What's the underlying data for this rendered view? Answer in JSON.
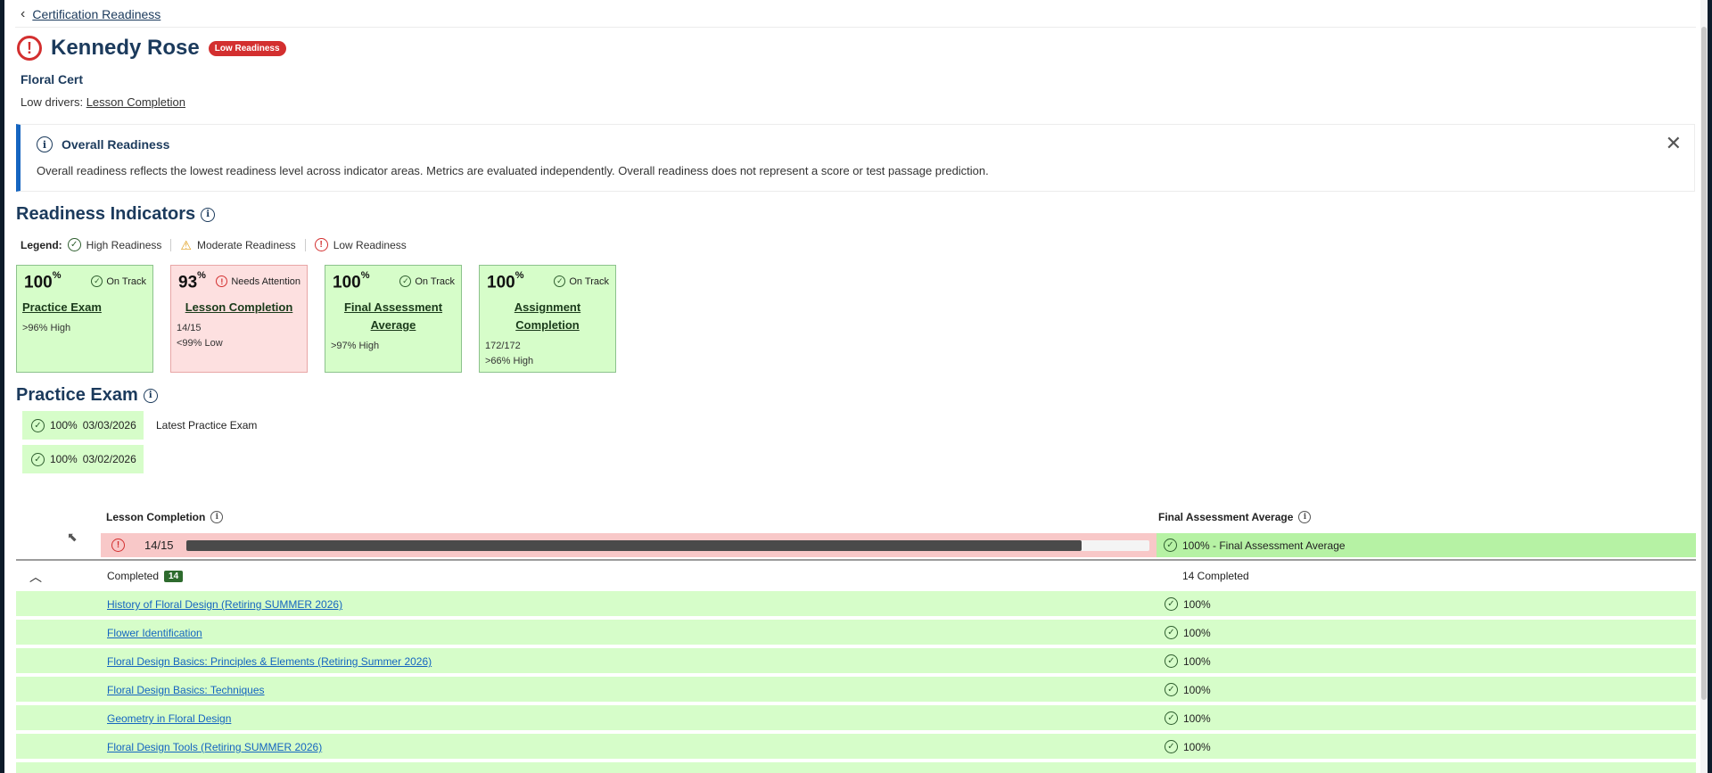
{
  "breadcrumb": {
    "back_label": "Certification Readiness"
  },
  "student": {
    "name": "Kennedy Rose",
    "readiness_badge": "Low Readiness",
    "cert": "Floral Cert",
    "drivers_label": "Low drivers:",
    "drivers_value": "Lesson Completion"
  },
  "info_box": {
    "title": "Overall Readiness",
    "text": "Overall readiness reflects the lowest readiness level across indicator areas. Metrics are evaluated independently. Overall readiness does not represent a score or test passage prediction."
  },
  "indicators": {
    "title": "Readiness Indicators",
    "legend": {
      "label": "Legend:",
      "high": "High Readiness",
      "moderate": "Moderate Readiness",
      "low": "Low Readiness"
    },
    "cards": [
      {
        "pct": "100",
        "status": "On Track",
        "title_line1": "Practice Exam",
        "title_line2": "",
        "meta1": ">96% High",
        "meta2": "",
        "level": "high"
      },
      {
        "pct": "93",
        "status": "Needs Attention",
        "title_line1": "Lesson Completion",
        "title_line2": "",
        "meta1": "14/15",
        "meta2": "<99% Low",
        "level": "low"
      },
      {
        "pct": "100",
        "status": "On Track",
        "title_line1": "Final Assessment",
        "title_line2": "Average",
        "meta1": ">97% High",
        "meta2": "",
        "level": "high"
      },
      {
        "pct": "100",
        "status": "On Track",
        "title_line1": "Assignment",
        "title_line2": "Completion",
        "meta1": "172/172",
        "meta2": ">66% High",
        "level": "high"
      }
    ],
    "pct_symbol": "%"
  },
  "practice_exam": {
    "title": "Practice Exam",
    "attempts": [
      {
        "score": "100%",
        "date": "03/03/2026"
      },
      {
        "score": "100%",
        "date": "03/02/2026"
      }
    ],
    "latest_label": "Latest Practice Exam"
  },
  "lesson_table": {
    "col_lesson": "Lesson Completion",
    "col_final": "Final Assessment Average",
    "progress": {
      "count": "14/15",
      "fraction": 0.93,
      "final_text": "100% - Final Assessment Average"
    },
    "completed": {
      "label": "Completed",
      "count": "14",
      "right_label": "14 Completed"
    },
    "lessons": [
      {
        "name": "History of Floral Design (Retiring SUMMER 2026)",
        "score": "100%"
      },
      {
        "name": "Flower Identification",
        "score": "100%"
      },
      {
        "name": "Floral Design Basics: Principles & Elements (Retiring Summer 2026)",
        "score": "100%"
      },
      {
        "name": "Floral Design Basics: Techniques",
        "score": "100%"
      },
      {
        "name": "Geometry in Floral Design",
        "score": "100%"
      },
      {
        "name": "Floral Design Tools (Retiring SUMMER 2026)",
        "score": "100%"
      }
    ]
  },
  "colors": {
    "high_bg": "#d6fdc9",
    "low_bg": "#fde0e0",
    "accent": "#1565c0",
    "danger": "#d32f2f",
    "brand_text": "#1b3a5c"
  }
}
